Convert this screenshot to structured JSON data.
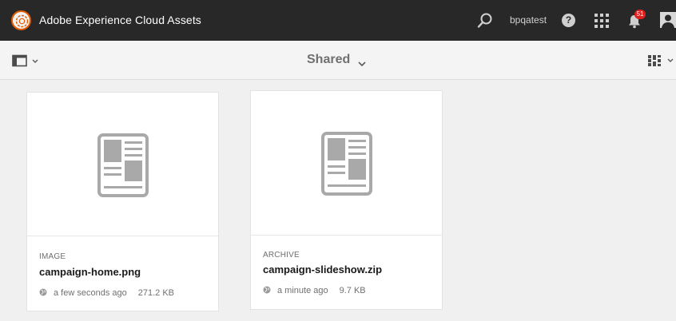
{
  "shell": {
    "app_title": "Adobe Experience Cloud Assets",
    "username": "bpqatest",
    "help_glyph": "?",
    "notification_count": "51",
    "icons": [
      "adobe-logo-icon",
      "search-icon",
      "help-icon",
      "apps-grid-icon",
      "bell-icon",
      "user-profile-icon"
    ]
  },
  "actionbar": {
    "location_label": "Shared",
    "icons": [
      "rail-toggle-icon",
      "chevron-down-icon",
      "view-switcher-icon"
    ]
  },
  "cards": [
    {
      "type": "IMAGE",
      "name": "campaign-home.png",
      "modified": "a few seconds ago",
      "size": "271.2 KB",
      "thumbnail_icon": "document-layout-icon"
    },
    {
      "type": "ARCHIVE",
      "name": "campaign-slideshow.zip",
      "modified": "a minute ago",
      "size": "9.7 KB",
      "thumbnail_icon": "document-layout-icon"
    }
  ],
  "colors": {
    "shell_bg": "#282828",
    "brand_accent": "#e35a00",
    "badge": "#e01f1f",
    "page_bg": "#f0f0f0"
  }
}
